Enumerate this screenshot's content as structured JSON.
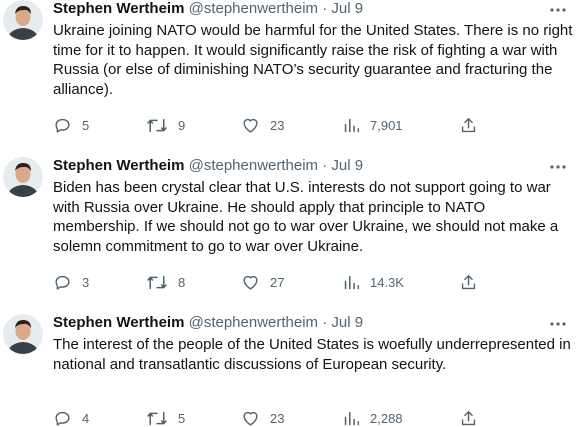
{
  "tweets": [
    {
      "author_name": "Stephen Wertheim",
      "handle": "@stephenwertheim",
      "separator": "·",
      "time": "Jul 9",
      "text": "Ukraine joining NATO would be harmful for the United States. There is no right time for it to happen. It would significantly raise the risk of fighting a war with Russia (or else of diminishing NATO’s security guarantee and fracturing the alliance).",
      "replies": "5",
      "retweets": "9",
      "likes": "23",
      "views": "7,901"
    },
    {
      "author_name": "Stephen Wertheim",
      "handle": "@stephenwertheim",
      "separator": "·",
      "time": "Jul 9",
      "text": "Biden has been crystal clear that U.S. interests do not support going to war with Russia over Ukraine. He should apply that principle to NATO membership. If we should not go to war over Ukraine, we should not make a solemn commitment to go to war over Ukraine.",
      "replies": "3",
      "retweets": "8",
      "likes": "27",
      "views": "14.3K"
    },
    {
      "author_name": "Stephen Wertheim",
      "handle": "@stephenwertheim",
      "separator": "·",
      "time": "Jul 9",
      "text": "The interest of the people of the United States is woefully underrepresented in national and transatlantic discussions of European security.",
      "replies": "4",
      "retweets": "5",
      "likes": "23",
      "views": "2,288"
    }
  ],
  "icons": {
    "reply": "reply-icon",
    "retweet": "retweet-icon",
    "like": "heart-icon",
    "views": "views-icon",
    "share": "share-icon",
    "more": "more-icon"
  },
  "colors": {
    "text": "#0f1419",
    "secondary": "#536471"
  }
}
